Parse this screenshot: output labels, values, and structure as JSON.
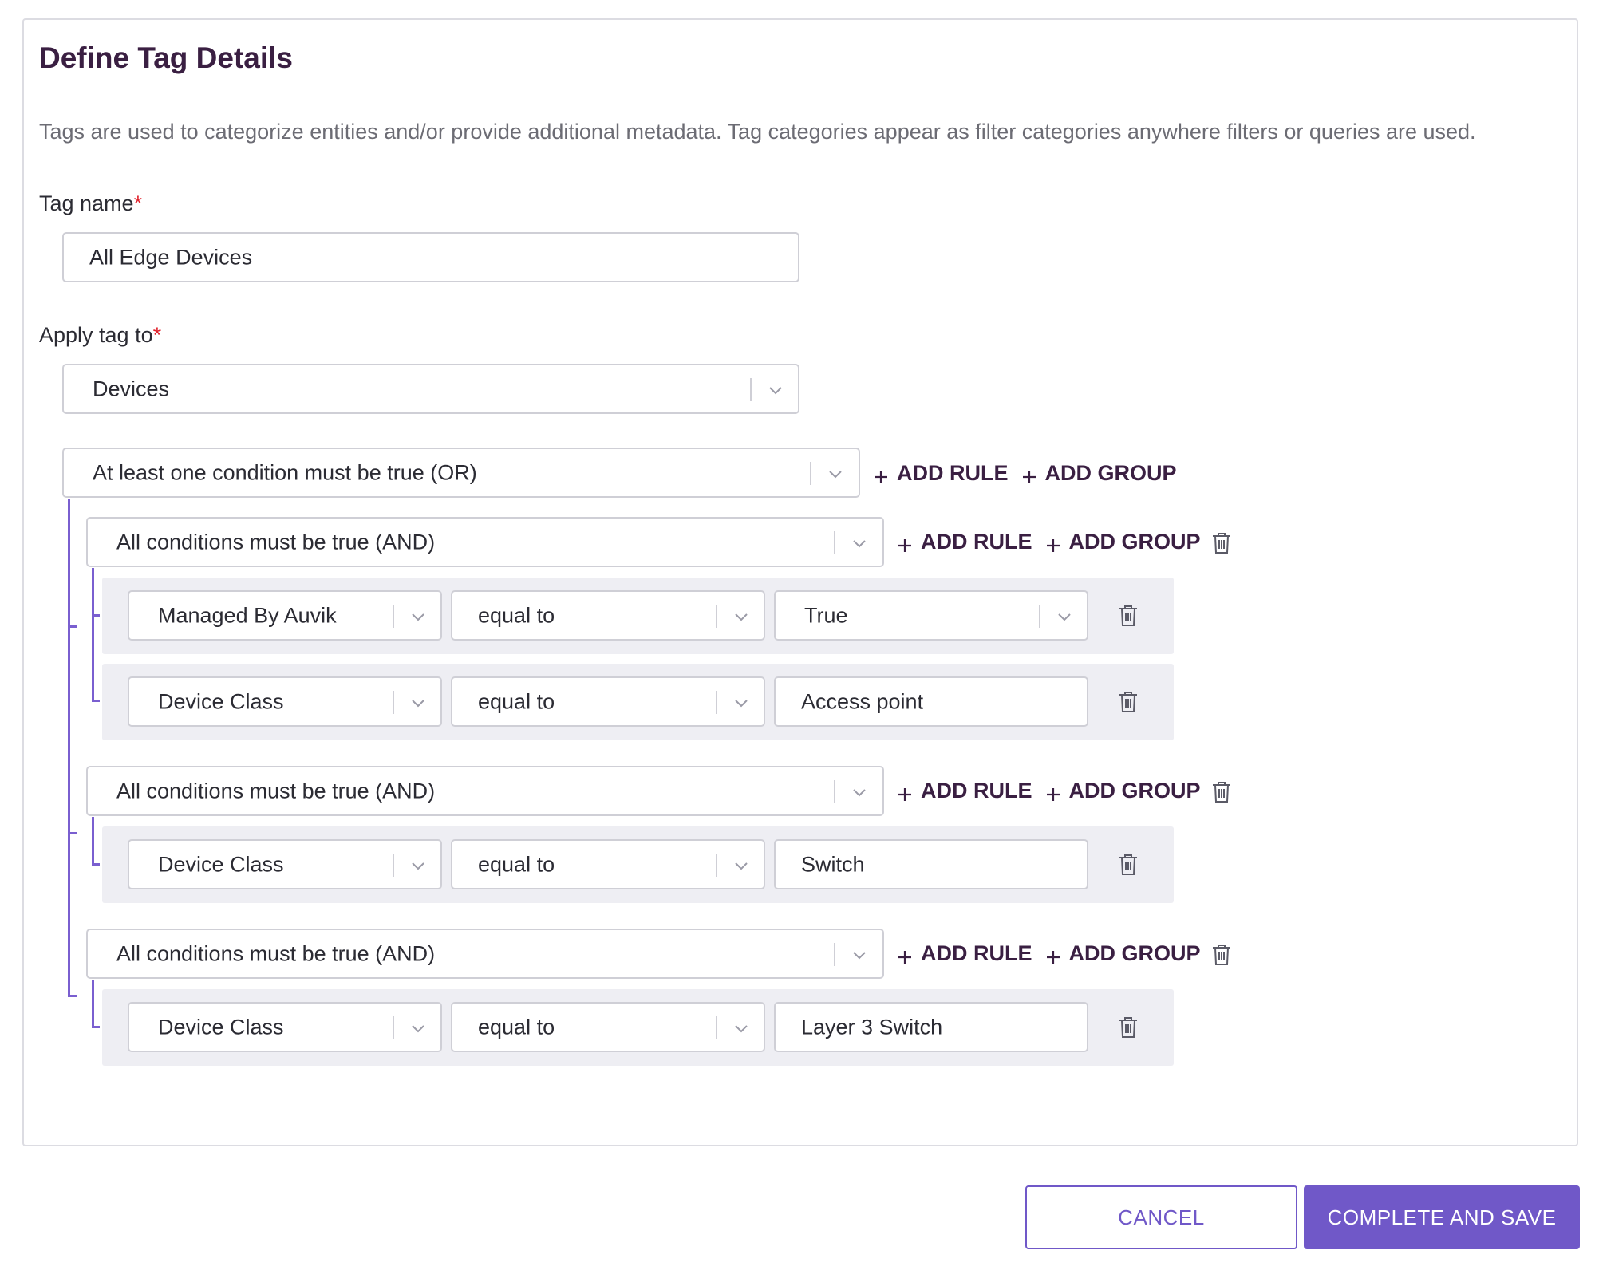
{
  "form": {
    "title": "Define Tag Details",
    "description": "Tags are used to categorize entities and/or provide additional metadata. Tag categories appear as filter categories anywhere filters or queries are used.",
    "tag_name_label": "Tag name",
    "required_mark": "*",
    "tag_name_value": "All Edge Devices",
    "apply_to_label": "Apply tag to",
    "apply_to_value": "Devices"
  },
  "query": {
    "root_condition": "At least one condition must be true (OR)",
    "add_rule_label": "ADD RULE",
    "add_group_label": "ADD GROUP",
    "groups": [
      {
        "condition": "All conditions must be true (AND)",
        "rules": [
          {
            "field": "Managed By Auvik",
            "operator": "equal to",
            "value": "True"
          },
          {
            "field": "Device Class",
            "operator": "equal to",
            "value": "Access point"
          }
        ]
      },
      {
        "condition": "All conditions must be true (AND)",
        "rules": [
          {
            "field": "Device Class",
            "operator": "equal to",
            "value": "Switch"
          }
        ]
      },
      {
        "condition": "All conditions must be true (AND)",
        "rules": [
          {
            "field": "Device Class",
            "operator": "equal to",
            "value": "Layer 3 Switch"
          }
        ]
      }
    ]
  },
  "footer": {
    "cancel_label": "CANCEL",
    "save_label": "COMPLETE AND SAVE"
  },
  "colors": {
    "accent": "#7058c8",
    "bracket": "#7a5fd0",
    "title": "#3a1f42",
    "required": "#e0222c",
    "rule_background": "#eeeef3"
  },
  "icons": {
    "dropdown": "chevron-down-icon",
    "delete": "trash-icon",
    "add": "plus-icon"
  }
}
